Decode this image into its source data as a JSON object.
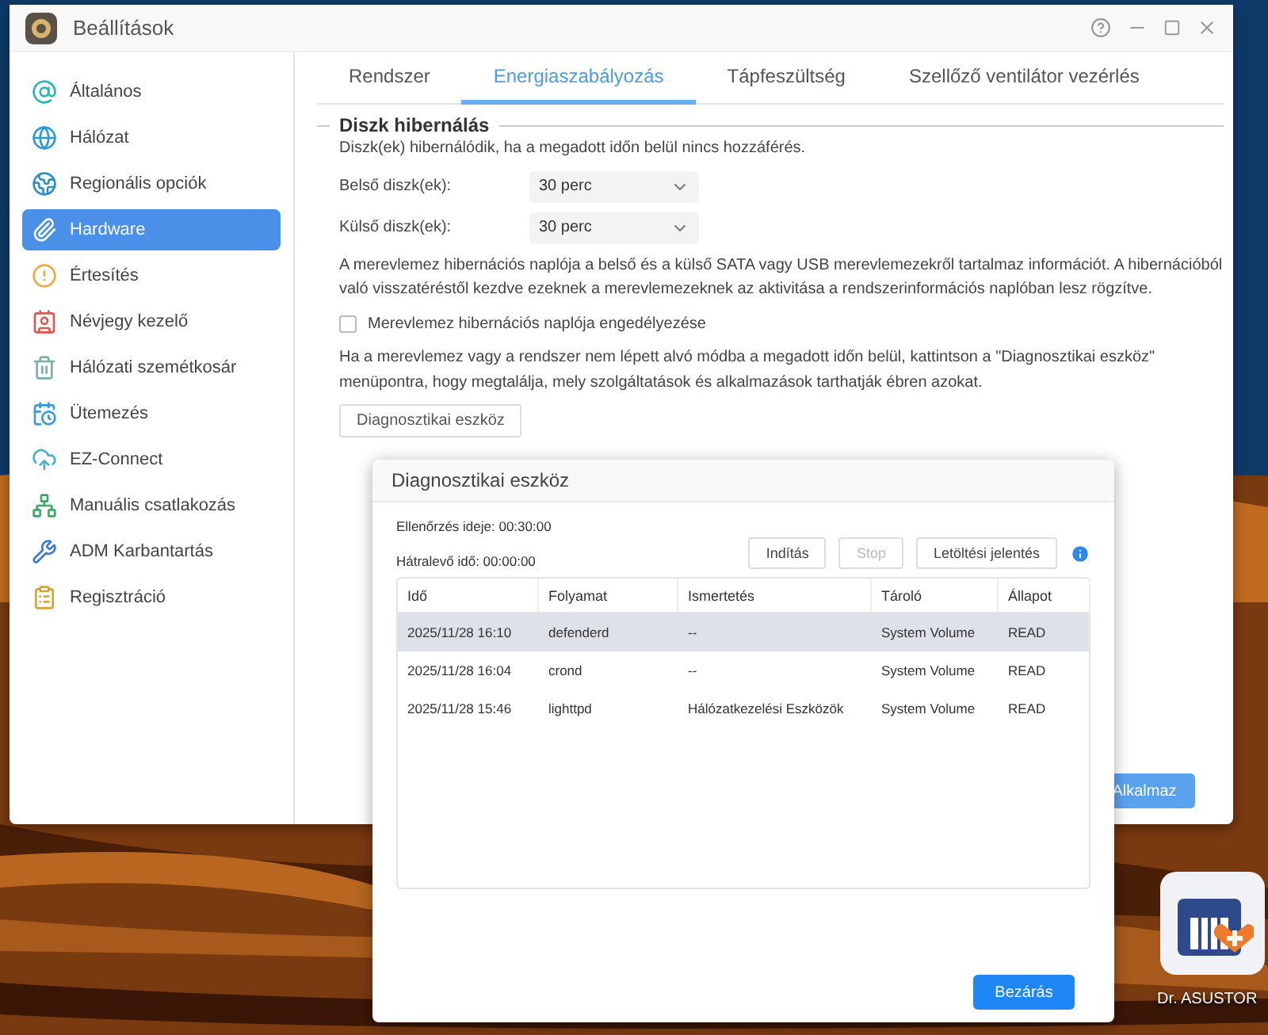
{
  "window": {
    "title": "Beállítások"
  },
  "sidebar": {
    "items": [
      {
        "label": "Általános",
        "selected": false
      },
      {
        "label": "Hálózat",
        "selected": false
      },
      {
        "label": "Regionális opciók",
        "selected": false
      },
      {
        "label": "Hardware",
        "selected": true
      },
      {
        "label": "Értesítés",
        "selected": false
      },
      {
        "label": "Névjegy kezelő",
        "selected": false
      },
      {
        "label": "Hálózati szemétkosár",
        "selected": false
      },
      {
        "label": "Ütemezés",
        "selected": false
      },
      {
        "label": "EZ-Connect",
        "selected": false
      },
      {
        "label": "Manuális csatlakozás",
        "selected": false
      },
      {
        "label": "ADM Karbantartás",
        "selected": false
      },
      {
        "label": "Regisztráció",
        "selected": false
      }
    ]
  },
  "tabs": [
    {
      "label": "Rendszer",
      "selected": false
    },
    {
      "label": "Energiaszabályozás",
      "selected": true
    },
    {
      "label": "Tápfeszültség",
      "selected": false
    },
    {
      "label": "Szellőző ventilátor vezérlés",
      "selected": false
    }
  ],
  "section": {
    "title": "Diszk hibernálás",
    "description": "Diszk(ek) hibernálódik, ha a megadott időn belül nincs hozzáférés.",
    "fields": [
      {
        "label": "Belső diszk(ek):",
        "value": "30 perc"
      },
      {
        "label": "Külső diszk(ek):",
        "value": "30 perc"
      }
    ],
    "log_info": "A merevlemez hibernációs naplója a belső és a külső SATA vagy USB merevlemezekről tartalmaz információt. A hibernációból való visszatéréstől kezdve ezeknek a merevlemezeknek az aktivitása a rendszerinformációs naplóban lesz rögzítve.",
    "log_checkbox": {
      "label": "Merevlemez hibernációs naplója engedélyezése",
      "checked": false
    },
    "help": "Ha a merevlemez vagy a rendszer nem lépett alvó módba a megadott időn belül, kattintson a \"Diagnosztikai eszköz\" menüpontra, hogy megtalálja, mely szolgáltatások és alkalmazások tarthatják ébren azokat.",
    "diagnostic_button": "Diagnosztikai eszköz"
  },
  "apply_button": "Alkalmaz",
  "dialog": {
    "title": "Diagnosztikai eszköz",
    "check_time": "Ellenőrzés ideje: 00:30:00",
    "remaining": "Hátralevő idő: 00:00:00",
    "buttons": [
      {
        "label": "Indítás",
        "disabled": false
      },
      {
        "label": "Stop",
        "disabled": true
      },
      {
        "label": "Letöltési jelentés",
        "disabled": false
      }
    ],
    "table": {
      "columns": [
        "Idő",
        "Folyamat",
        "Ismertetés",
        "Tároló",
        "Állapot"
      ],
      "rows": [
        {
          "cells": [
            "2025/11/28 16:10",
            "defenderd",
            "--",
            "System Volume",
            "READ"
          ],
          "selected": true
        },
        {
          "cells": [
            "2025/11/28 16:04",
            "crond",
            "--",
            "System Volume",
            "READ"
          ],
          "selected": false
        },
        {
          "cells": [
            "2025/11/28 15:46",
            "lighttpd",
            "Hálózatkezelési Eszközök",
            "System Volume",
            "READ"
          ],
          "selected": false
        }
      ]
    },
    "close_button": "Bezárás"
  },
  "desktop_icon": {
    "label": "Dr. ASUSTOR"
  }
}
